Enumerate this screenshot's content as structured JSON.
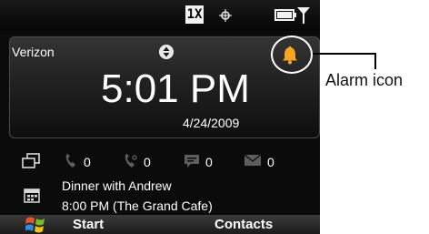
{
  "status_bar": {
    "network_badge": "1X",
    "icons": [
      "crosshair-icon",
      "battery-icon",
      "signal-icon"
    ]
  },
  "home": {
    "carrier": "Verizon",
    "time": "5:01 PM",
    "date": "4/24/2009",
    "alarm": "alarm-bell-icon"
  },
  "counters": [
    {
      "icon": "missed-call-icon",
      "value": "0"
    },
    {
      "icon": "voicemail-icon",
      "value": "0"
    },
    {
      "icon": "text-message-icon",
      "value": "0"
    },
    {
      "icon": "email-icon",
      "value": "0"
    }
  ],
  "appointment": {
    "title": "Dinner with Andrew",
    "details": "8:00 PM (The Grand Cafe)"
  },
  "softkeys": {
    "left": "Start",
    "right": "Contacts"
  },
  "callout": {
    "label": "Alarm icon"
  },
  "colors": {
    "alarm": "#f5a623",
    "counter_icon": "#5e5e5e",
    "screen_bg": "#0b0b0b"
  }
}
